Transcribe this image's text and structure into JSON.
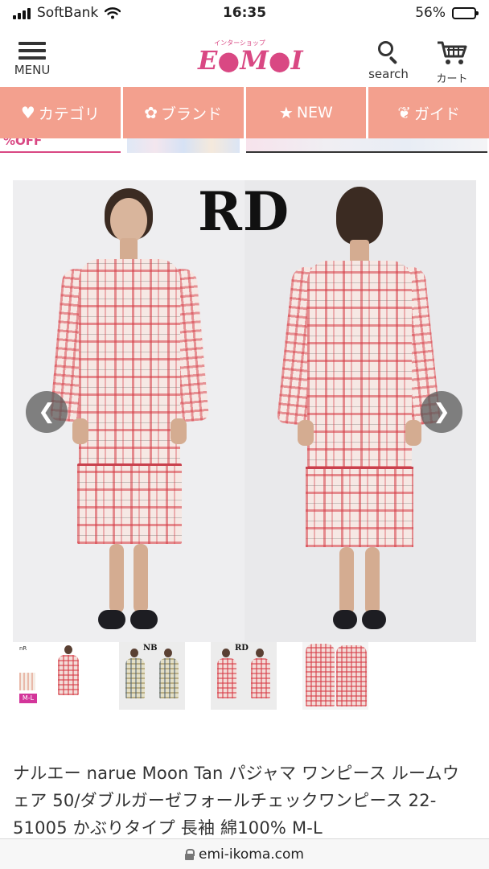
{
  "status_bar": {
    "carrier": "SoftBank",
    "time": "16:35",
    "battery": "56%",
    "battery_level": 0.56
  },
  "header": {
    "menu_label": "MENU",
    "logo_tagline": "インターショップ",
    "logo_text": "E●M●I",
    "search_label": "search",
    "cart_label": "カート"
  },
  "nav": {
    "tabs": [
      {
        "icon": "heart-icon",
        "label": "カテゴリ"
      },
      {
        "icon": "flower-icon",
        "label": "ブランド"
      },
      {
        "icon": "star-icon",
        "label": "NEW"
      },
      {
        "icon": "leaf-icon",
        "label": "ガイド"
      }
    ]
  },
  "banner": {
    "fragment": "%OFF"
  },
  "carousel": {
    "image_label": "RD",
    "prev_icon": "chevron-left-icon",
    "next_icon": "chevron-right-icon"
  },
  "thumbnails": [
    {
      "label": "",
      "brand_text": "nR",
      "size_text": "M-L"
    },
    {
      "label": "NB"
    },
    {
      "label": "RD"
    },
    {
      "label": ""
    }
  ],
  "product": {
    "title": "ナルエー narue Moon Tan パジャマ ワンピース ルームウェア 50/ダブルガーゼフォールチェックワンピース 22-51005 かぶりタイプ 長袖 綿100% M-L"
  },
  "browser": {
    "url": "emi-ikoma.com"
  },
  "colors": {
    "nav_bg": "#f3a08e",
    "logo": "#d94883"
  }
}
